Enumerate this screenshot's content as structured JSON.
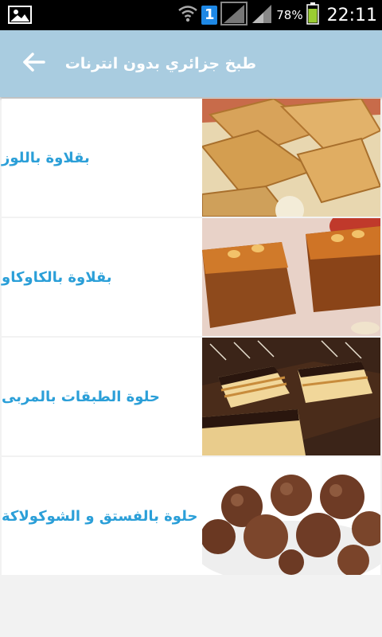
{
  "status_bar": {
    "notification_badge": "1",
    "battery_percent": "78%",
    "time": "22:11",
    "icons": [
      "gallery-icon",
      "wifi-icon",
      "sim-icon",
      "signal-icon",
      "battery-icon"
    ]
  },
  "app_bar": {
    "title": "طبخ جزائري بدون انترنات",
    "back_icon": "arrow-left-icon",
    "color": "#a9cce0"
  },
  "recipes": [
    {
      "label": "بقلاوة باللوز",
      "image": "baklava-almond-photo"
    },
    {
      "label": "بقلاوة بالكاوكاو",
      "image": "baklava-peanut-photo"
    },
    {
      "label": "حلوة الطبقات بالمربى",
      "image": "layer-cake-jam-photo"
    },
    {
      "label": "حلوة بالفستق و الشوكولاكة",
      "image": "pistachio-chocolate-truffles-photo"
    }
  ],
  "colors": {
    "label_text": "#2b9fd8",
    "background": "#f2f2f2",
    "row_background": "#ffffff"
  }
}
